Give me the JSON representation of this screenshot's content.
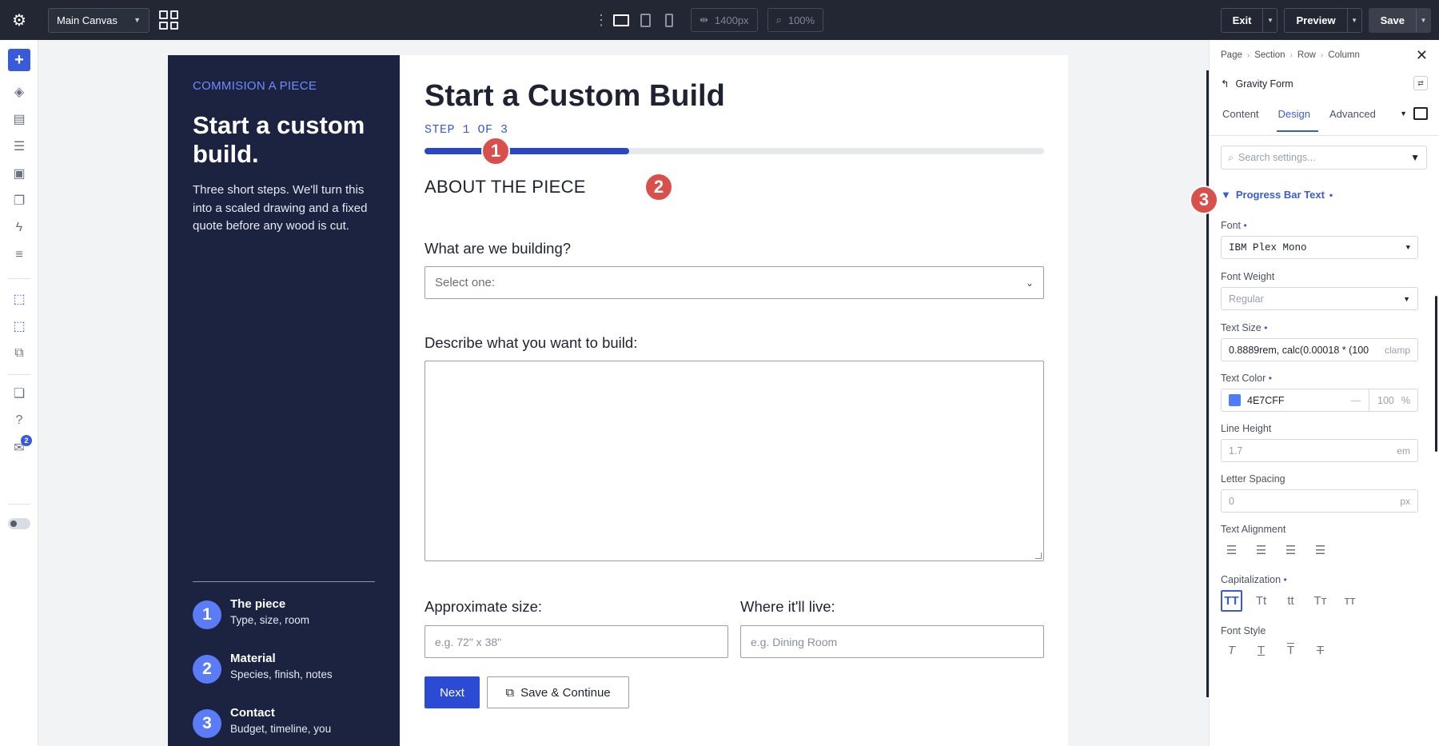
{
  "topbar": {
    "canvas_select": "Main Canvas",
    "width_value": "1400px",
    "zoom_value": "100%",
    "exit_label": "Exit",
    "preview_label": "Preview",
    "save_label": "Save"
  },
  "rail": {
    "notification_count": "2"
  },
  "content": {
    "eyebrow": "COMMISION A PIECE",
    "headline": "Start a custom build.",
    "intro": "Three short steps. We'll turn this into a scaled drawing and a fixed quote before any wood is cut.",
    "steps": [
      {
        "num": "1",
        "title": "The piece",
        "desc": "Type, size, room"
      },
      {
        "num": "2",
        "title": "Material",
        "desc": "Species, finish, notes"
      },
      {
        "num": "3",
        "title": "Contact",
        "desc": "Budget, timeline, you"
      }
    ]
  },
  "form": {
    "title": "Start a Custom Build",
    "step_label": "STEP 1 OF 3",
    "progress": 0.33,
    "section": "ABOUT THE PIECE",
    "q_building": "What are we building?",
    "select_placeholder": "Select one:",
    "q_describe": "Describe what you want to build:",
    "q_size": "Approximate size:",
    "size_placeholder": "e.g. 72\" x 38\"",
    "q_live": "Where it'll live:",
    "live_placeholder": "e.g. Dining Room",
    "next_label": "Next",
    "save_continue_label": "Save & Continue"
  },
  "markers": [
    "1",
    "2",
    "3"
  ],
  "panel": {
    "breadcrumbs": [
      "Page",
      "Section",
      "Row",
      "Column"
    ],
    "module": "Gravity Form",
    "tabs": [
      "Content",
      "Design",
      "Advanced"
    ],
    "active_tab": "Design",
    "search_placeholder": "Search settings...",
    "group_title": "Progress Bar Text",
    "font_label": "Font",
    "font_value": "IBM Plex Mono",
    "weight_label": "Font Weight",
    "weight_value": "Regular",
    "size_label": "Text Size",
    "size_value": "0.8889rem, calc(0.00018 * (100",
    "size_unit": "clamp",
    "color_label": "Text Color",
    "color_value": "4E7CFF",
    "color_swatch": "#4e7cff",
    "color_dash": "—",
    "opacity_value": "100",
    "opacity_unit": "%",
    "lh_label": "Line Height",
    "lh_value": "1.7",
    "lh_unit": "em",
    "ls_label": "Letter Spacing",
    "ls_value": "0",
    "ls_unit": "px",
    "align_label": "Text Alignment",
    "cap_label": "Capitalization",
    "cap_options": [
      "TT",
      "Tt",
      "tt",
      "Tт",
      "ᴛᴛ"
    ],
    "style_label": "Font Style"
  },
  "colors": {
    "accent": "#3a5bd9",
    "dark_panel": "#1b2340",
    "marker": "#d8504b",
    "progress_fill": "#2847c7"
  }
}
